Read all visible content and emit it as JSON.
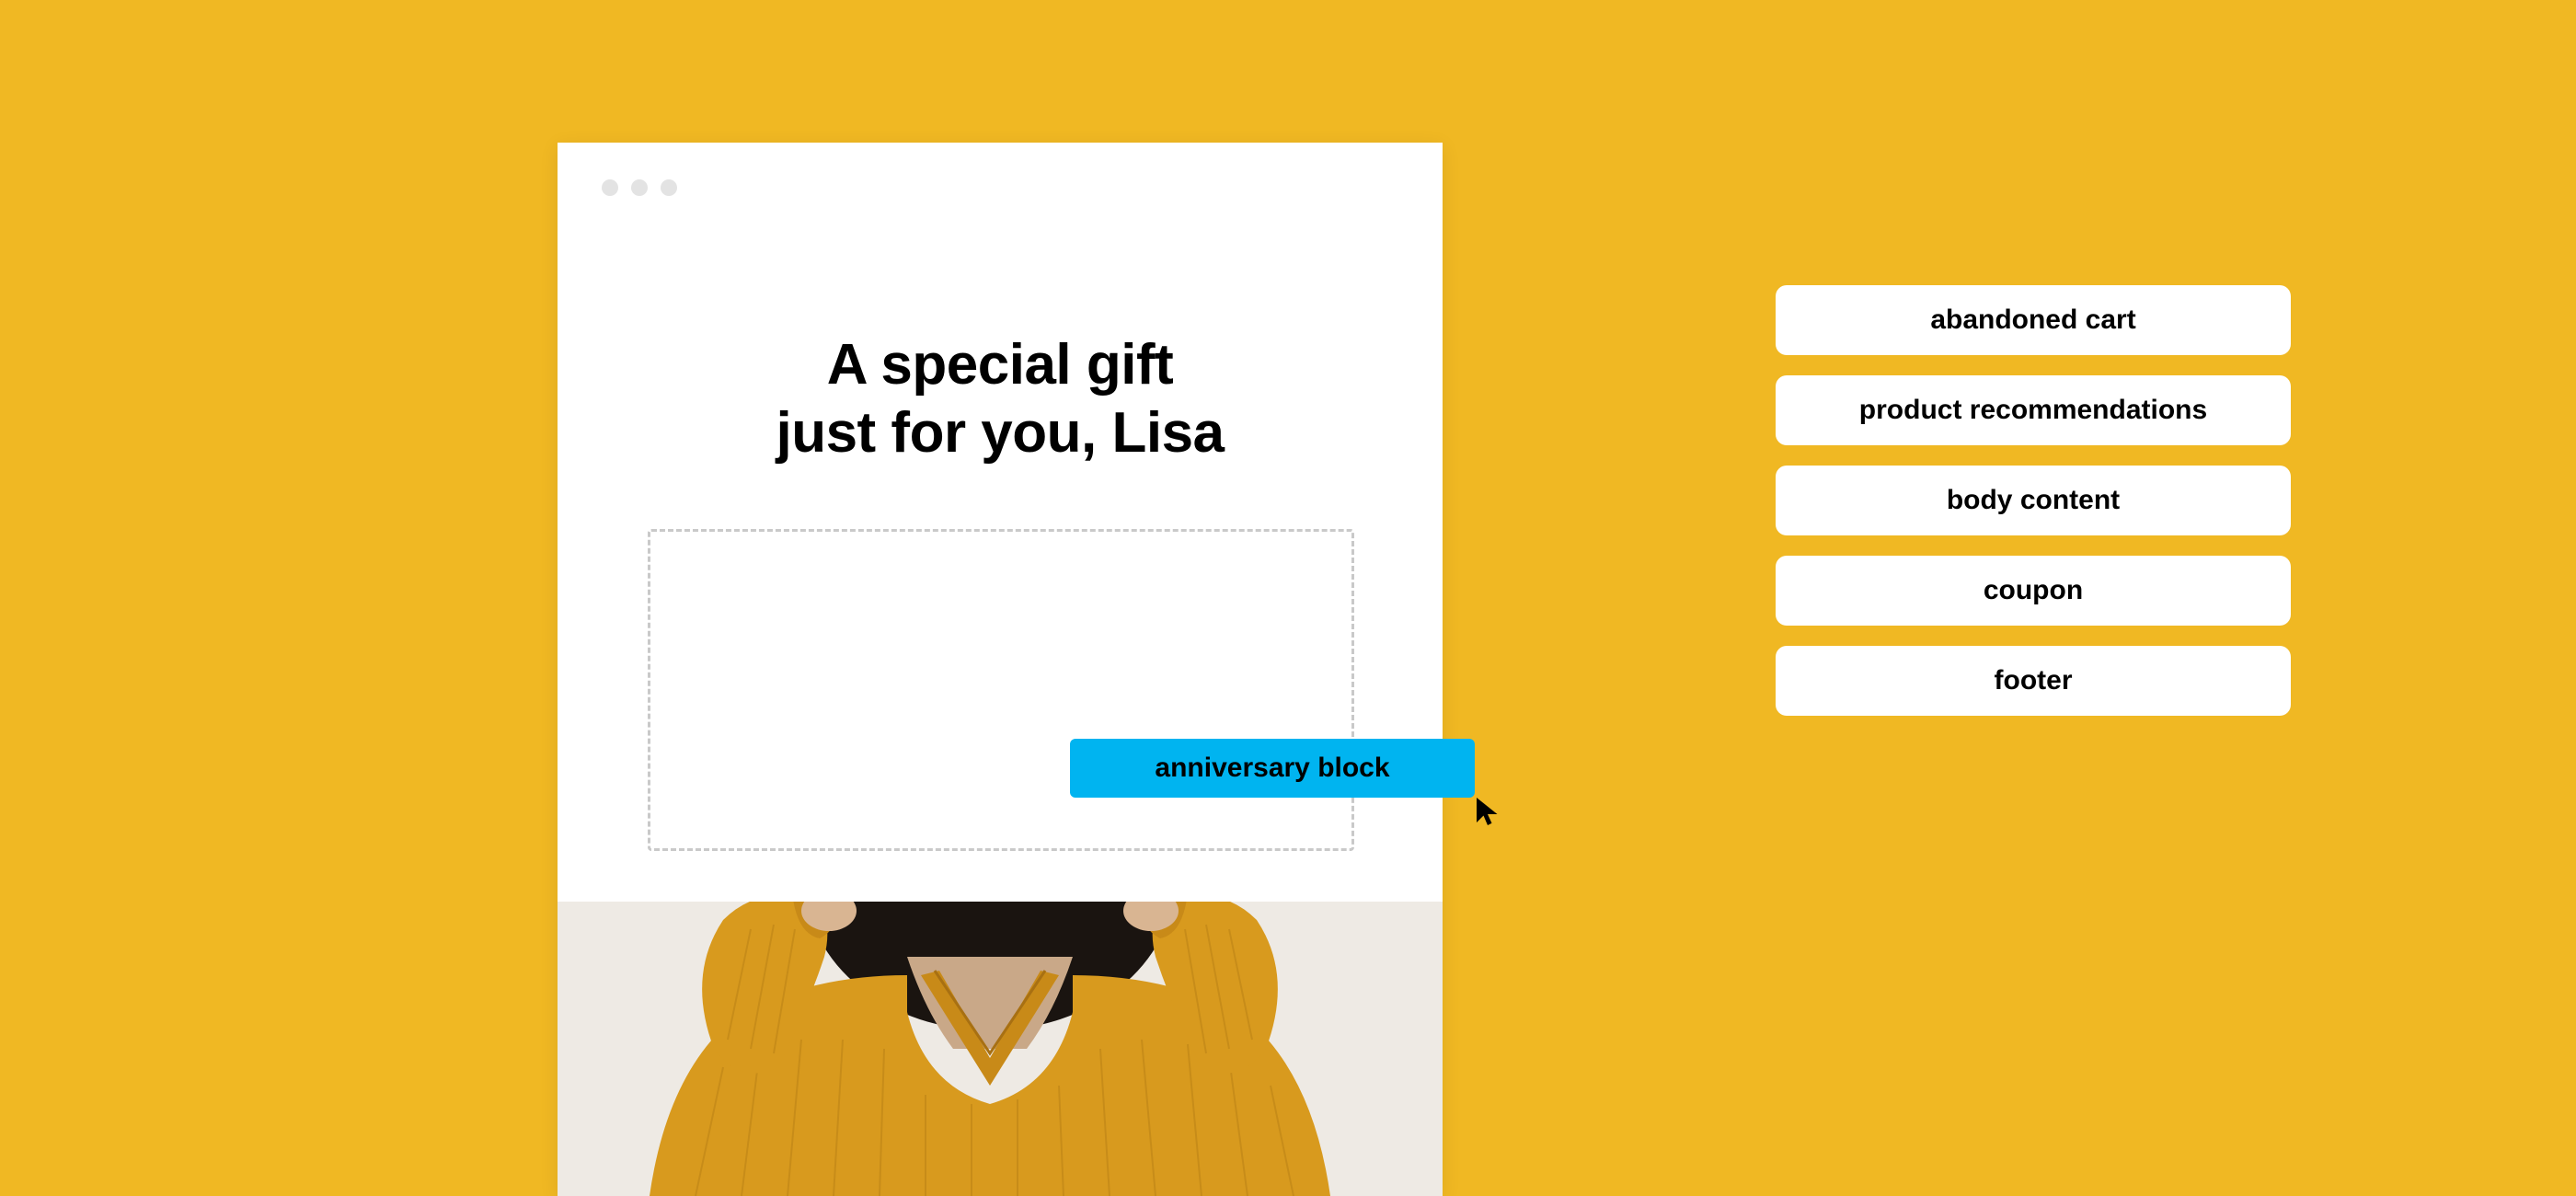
{
  "preview": {
    "headline_line1": "A special gift",
    "headline_line2": "just for you, Lisa",
    "dragging_block_label": "anniversary block"
  },
  "blocks_panel": {
    "items": [
      {
        "label": "abandoned cart"
      },
      {
        "label": "product recommendations"
      },
      {
        "label": "body content"
      },
      {
        "label": "coupon"
      },
      {
        "label": "footer"
      }
    ]
  },
  "colors": {
    "background": "#f0b823",
    "accent": "#00b4f0"
  }
}
